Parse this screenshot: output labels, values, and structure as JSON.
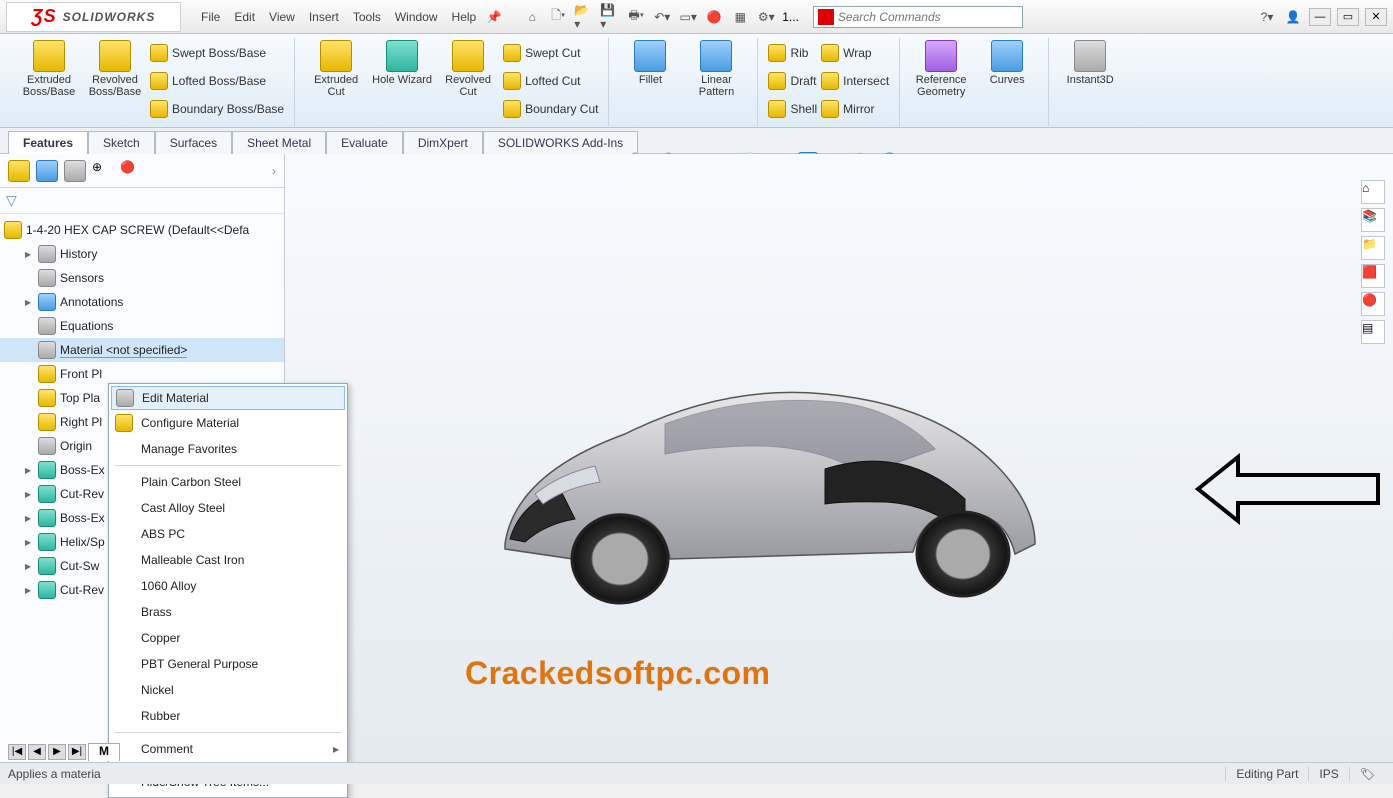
{
  "app": {
    "brand_ds": "ƷS",
    "brand_name": "SOLIDWORKS"
  },
  "menu": [
    "File",
    "Edit",
    "View",
    "Insert",
    "Tools",
    "Window",
    "Help"
  ],
  "qat_num": "1...",
  "search": {
    "placeholder": "Search Commands"
  },
  "ribbon": {
    "g1": {
      "extruded": "Extruded Boss/Base",
      "revolved": "Revolved Boss/Base",
      "swept": "Swept Boss/Base",
      "lofted": "Lofted Boss/Base",
      "boundary": "Boundary Boss/Base"
    },
    "g2": {
      "extcut": "Extruded Cut",
      "hole": "Hole Wizard",
      "revcut": "Revolved Cut",
      "sweptcut": "Swept Cut",
      "loftcut": "Lofted Cut",
      "boundcut": "Boundary Cut"
    },
    "g3": {
      "fillet": "Fillet",
      "pattern": "Linear Pattern"
    },
    "g4": {
      "rib": "Rib",
      "draft": "Draft",
      "shell": "Shell",
      "wrap": "Wrap",
      "intersect": "Intersect",
      "mirror": "Mirror"
    },
    "g5": {
      "refgeo": "Reference Geometry",
      "curves": "Curves"
    },
    "g6": {
      "instant3d": "Instant3D"
    }
  },
  "tabs": [
    "Features",
    "Sketch",
    "Surfaces",
    "Sheet Metal",
    "Evaluate",
    "DimXpert",
    "SOLIDWORKS Add-Ins"
  ],
  "tree": {
    "root": "1-4-20 HEX CAP SCREW  (Default<<Defa",
    "nodes": [
      {
        "label": "History"
      },
      {
        "label": "Sensors"
      },
      {
        "label": "Annotations"
      },
      {
        "label": "Equations"
      },
      {
        "label": "Material <not specified>",
        "selected": true
      },
      {
        "label": "Front Pl"
      },
      {
        "label": "Top Pla"
      },
      {
        "label": "Right Pl"
      },
      {
        "label": "Origin"
      },
      {
        "label": "Boss-Ex"
      },
      {
        "label": "Cut-Rev"
      },
      {
        "label": "Boss-Ex"
      },
      {
        "label": "Helix/Sp"
      },
      {
        "label": "Cut-Sw"
      },
      {
        "label": "Cut-Rev"
      }
    ]
  },
  "context_menu": {
    "edit": "Edit Material",
    "config": "Configure Material",
    "favs": "Manage Favorites",
    "materials": [
      "Plain Carbon Steel",
      "Cast Alloy Steel",
      "ABS PC",
      "Malleable Cast Iron",
      "1060 Alloy",
      "Brass",
      "Copper",
      "PBT General Purpose",
      "Nickel",
      "Rubber"
    ],
    "comment": "Comment",
    "hideshow": "Hide/Show Tree Items..."
  },
  "sheettab": "M",
  "watermark": "Crackedsoftpc.com",
  "status": {
    "hint": "Applies a materia",
    "mode": "Editing Part",
    "units": "IPS"
  }
}
